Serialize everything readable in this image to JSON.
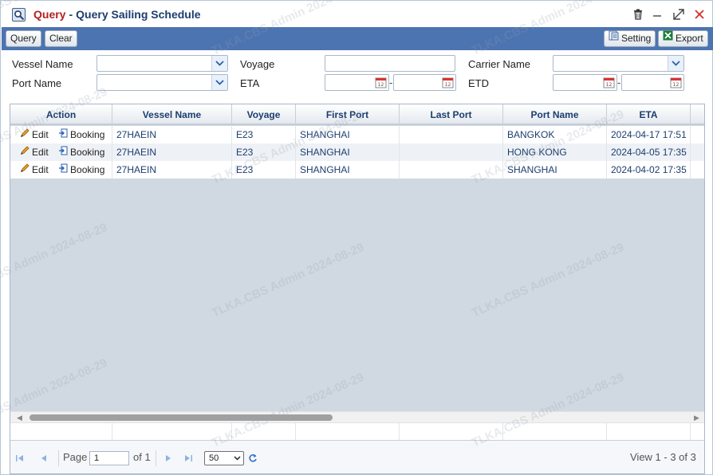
{
  "window": {
    "title_part1": "Query",
    "title_part2": "Query Sailing Schedule",
    "title_separator": "-"
  },
  "toolbar": {
    "query_label": "Query",
    "clear_label": "Clear",
    "setting_label": "Setting",
    "export_label": "Export"
  },
  "form": {
    "vessel_name_label": "Vessel Name",
    "voyage_label": "Voyage",
    "carrier_name_label": "Carrier Name",
    "port_name_label": "Port Name",
    "eta_label": "ETA",
    "etd_label": "ETD",
    "range_separator": "-",
    "vessel_name_value": "",
    "voyage_value": "",
    "carrier_name_value": "",
    "port_name_value": "",
    "eta_from": "",
    "eta_to": "",
    "etd_from": "",
    "etd_to": ""
  },
  "grid": {
    "columns": [
      "Action",
      "Vessel Name",
      "Voyage",
      "First Port",
      "Last Port",
      "Port Name",
      "ETA"
    ],
    "action_edit": "Edit",
    "action_booking": "Booking",
    "rows": [
      {
        "vessel": "27HAEIN",
        "voyage": "E23",
        "first_port": "SHANGHAI",
        "last_port": "",
        "port_name": "BANGKOK",
        "eta": "2024-04-17 17:51"
      },
      {
        "vessel": "27HAEIN",
        "voyage": "E23",
        "first_port": "SHANGHAI",
        "last_port": "",
        "port_name": "HONG KONG",
        "eta": "2024-04-05 17:35"
      },
      {
        "vessel": "27HAEIN",
        "voyage": "E23",
        "first_port": "SHANGHAI",
        "last_port": "",
        "port_name": "SHANGHAI",
        "eta": "2024-04-02 17:35"
      }
    ]
  },
  "pager": {
    "page_label": "Page",
    "page_value": "1",
    "of_label": "of 1",
    "page_size": "50",
    "view_text": "View 1 - 3 of 3"
  },
  "watermark": {
    "text": "TLKA.CBS Admin 2024-08-29"
  },
  "colors": {
    "toolbar_bg": "#4c74b1",
    "title_red": "#b42020",
    "title_blue": "#1c3d6e",
    "close_red": "#d62c2c"
  }
}
